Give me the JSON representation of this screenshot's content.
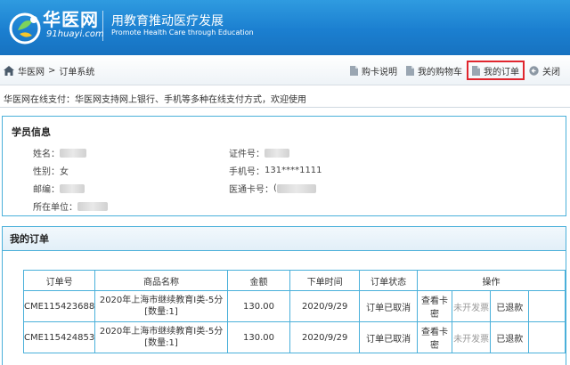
{
  "header": {
    "brand": "华医网",
    "brand_domain": "91huayi.com",
    "slogan": "用教育推动医疗发展",
    "slogan_en": "Promote Health Care through Education"
  },
  "nav": {
    "breadcrumb_home": "华医网",
    "breadcrumb_separator": ">",
    "breadcrumb_current": "订单系统",
    "links": [
      "购卡说明",
      "我的购物车",
      "我的订单",
      "关闭"
    ],
    "active_link": "我的订单"
  },
  "notice": "华医网在线支付：华医网支持网上银行、手机等多种在线支付方式，欢迎使用",
  "student": {
    "title": "学员信息",
    "name_label": "姓名：",
    "gender_label": "性别：",
    "gender_value": "女",
    "postcode_label": "邮编：",
    "workplace_label": "所在单位：",
    "idcard_label": "证件号：",
    "phone_label": "手机号：",
    "phone_value": "131****1111",
    "card_label": "医通卡号：",
    "card_value_prefix": "("
  },
  "orders": {
    "title": "我的订单",
    "columns": [
      "订单号",
      "商品名称",
      "金额",
      "下单时间",
      "订单状态",
      "操作"
    ],
    "rows": [
      {
        "order_no": "CME115423688",
        "product": "2020年上海市继续教育Ⅰ类-5分",
        "quantity": "[数量:1]",
        "amount": "130.00",
        "date": "2020/9/29",
        "status": "订单已取消",
        "action_view": "查看卡密",
        "action_invoice": "未开发票",
        "action_refund": "已退款"
      },
      {
        "order_no": "CME115424853",
        "product": "2020年上海市继续教育Ⅰ类-5分",
        "quantity": "[数量:1]",
        "amount": "130.00",
        "date": "2020/9/29",
        "status": "订单已取消",
        "action_view": "查看卡密",
        "action_invoice": "未开发票",
        "action_refund": "已退款"
      }
    ]
  },
  "colors": {
    "banner": "#1b7fd0",
    "panel_border": "#4ab0da",
    "active_highlight": "#e0262e"
  }
}
